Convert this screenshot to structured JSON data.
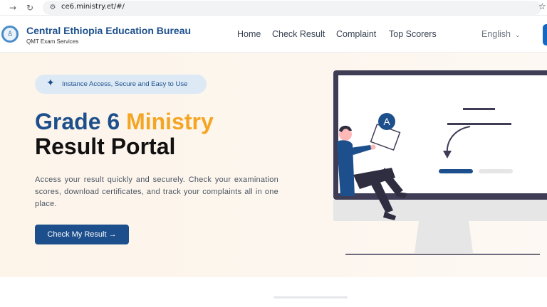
{
  "browser": {
    "back_icon": "arrow-left-icon",
    "reload_icon": "reload-icon",
    "url": "ce6.ministry.et/#/",
    "bookmark_icon": "star-icon"
  },
  "header": {
    "title": "Central Ethiopia Education Bureau",
    "subtitle": "QMT Exam Services",
    "nav": {
      "home": "Home",
      "check_result": "Check Result",
      "complaint": "Complaint",
      "top_scorers": "Top Scorers"
    },
    "language": "English"
  },
  "hero": {
    "badge": "Instance Access, Secure and Easy to Use",
    "heading_part1": "Grade 6",
    "heading_part2": "Ministry",
    "heading_line2": "Result Portal",
    "description": "Access your result quickly and securely. Check your examination scores, download certificates, and track your complaints all in one place.",
    "cta_label": "Check My Result →",
    "illustration_letter": "A"
  },
  "colors": {
    "brand_blue": "#1c4f8c",
    "accent_orange": "#f5a524",
    "hero_bg": "#fdf4ea"
  }
}
